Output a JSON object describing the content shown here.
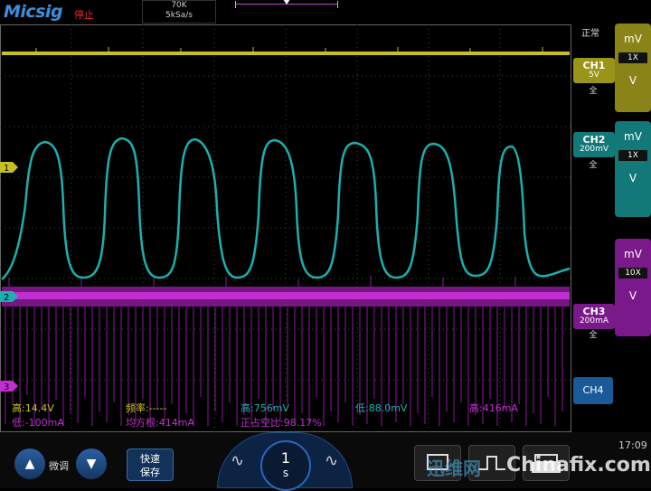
{
  "header": {
    "logo": "Micsig",
    "status": "停止",
    "samples": "70K",
    "sample_rate": "5kSa/s"
  },
  "trigger_mode": "正常",
  "channels": [
    {
      "name": "CH1",
      "scale": "5V",
      "coupling": "全",
      "unit": "mV",
      "probe": "1X",
      "unit2": "V",
      "color": "#c8c020",
      "marker": "1"
    },
    {
      "name": "CH2",
      "scale": "200mV",
      "coupling": "全",
      "unit": "mV",
      "probe": "1X",
      "unit2": "V",
      "color": "#1aa8a8",
      "marker": "2"
    },
    {
      "name": "CH3",
      "scale": "200mA",
      "coupling": "全",
      "unit": "mV",
      "probe": "10X",
      "unit2": "V",
      "color": "#b020c0",
      "marker": "3"
    },
    {
      "name": "CH4"
    }
  ],
  "measurements": {
    "row1": [
      "高:14.4V",
      "频率:-----",
      "高:756mV",
      "低:88.0mV",
      "高:416mA"
    ],
    "row2": [
      "低:-100mA",
      "均方根:414mA",
      "正占空比:98.17%"
    ]
  },
  "bottom": {
    "fine_label": "微调",
    "fast_save_1": "快速",
    "fast_save_2": "保存",
    "timebase_value": "1",
    "timebase_unit": "s",
    "clock": "17:09",
    "wm_a": "迅维网",
    "wm_b": "Chinafix.com",
    "up_icon": "▲",
    "down_icon": "▼",
    "wave_icon": "∿"
  },
  "colors": {
    "ch1": "#c8c020",
    "ch2": "#1aa8a8",
    "ch3": "#b020c0",
    "accent": "#1a5a98"
  }
}
